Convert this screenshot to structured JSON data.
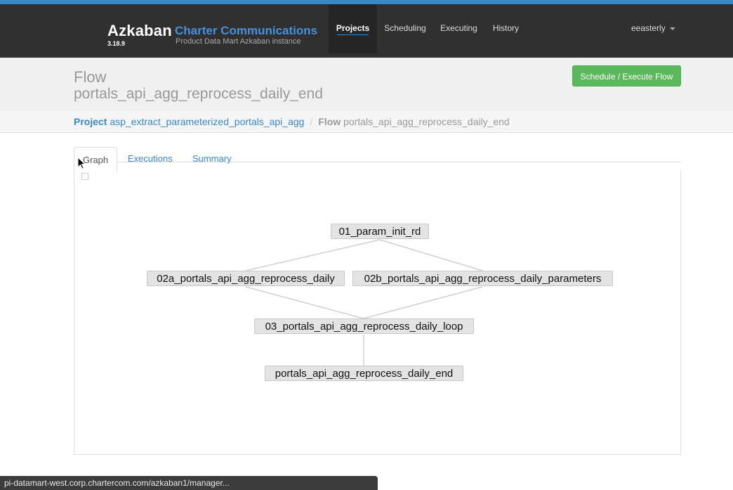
{
  "brand": {
    "name": "Azkaban",
    "version": "3.18.9",
    "company": "Charter Communications",
    "subtitle": "Product Data Mart Azkaban instance"
  },
  "nav": {
    "items": [
      {
        "label": "Projects",
        "active": true
      },
      {
        "label": "Scheduling",
        "active": false
      },
      {
        "label": "Executing",
        "active": false
      },
      {
        "label": "History",
        "active": false
      }
    ],
    "user": "eeasterly"
  },
  "header": {
    "label": "Flow",
    "flow_name": "portals_api_agg_reprocess_daily_end",
    "schedule_button": "Schedule / Execute Flow"
  },
  "breadcrumb": {
    "project_label": "Project",
    "project_name": "asp_extract_parameterized_portals_api_agg",
    "separator": "/",
    "flow_label": "Flow",
    "flow_name": "portals_api_agg_reprocess_daily_end"
  },
  "tabs": [
    {
      "label": "Graph",
      "active": true
    },
    {
      "label": "Executions",
      "active": false
    },
    {
      "label": "Summary",
      "active": false
    }
  ],
  "graph": {
    "nodes": [
      {
        "id": "n1",
        "label": "01_param_init_rd"
      },
      {
        "id": "n2a",
        "label": "02a_portals_api_agg_reprocess_daily"
      },
      {
        "id": "n2b",
        "label": "02b_portals_api_agg_reprocess_daily_parameters"
      },
      {
        "id": "n3",
        "label": "03_portals_api_agg_reprocess_daily_loop"
      },
      {
        "id": "n4",
        "label": "portals_api_agg_reprocess_daily_end"
      }
    ],
    "edges": [
      {
        "from": "n1",
        "to": "n2a"
      },
      {
        "from": "n1",
        "to": "n2b"
      },
      {
        "from": "n2a",
        "to": "n3"
      },
      {
        "from": "n2b",
        "to": "n3"
      },
      {
        "from": "n3",
        "to": "n4"
      }
    ]
  },
  "status_bar": {
    "url": "pi-datamart-west.corp.chartercom.com/azkaban1/manager..."
  },
  "colors": {
    "accent": "#3a87c8",
    "navbar": "#303030",
    "success": "#5cb85c"
  }
}
